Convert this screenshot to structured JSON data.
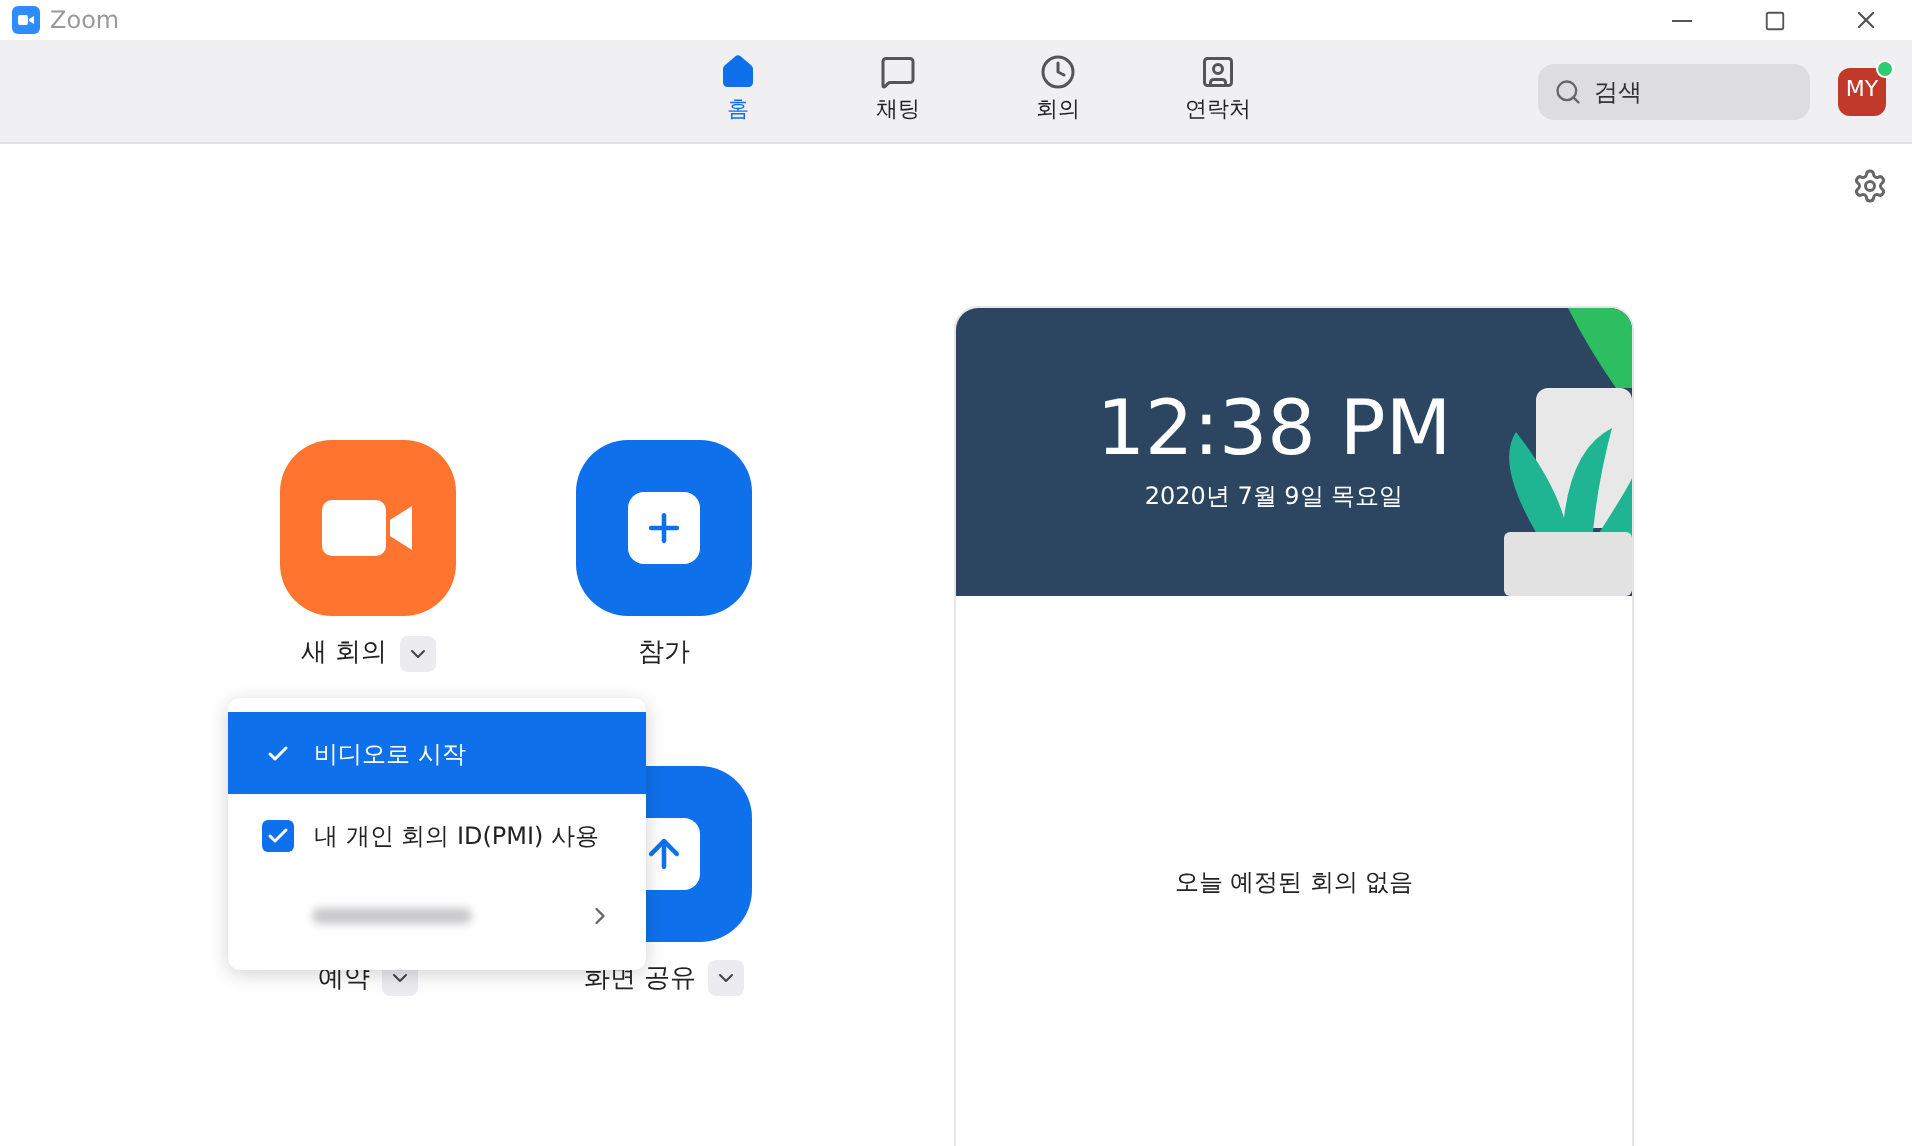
{
  "window": {
    "title": "Zoom"
  },
  "nav": {
    "tabs": [
      {
        "label": "홈",
        "kind": "home",
        "selected": true
      },
      {
        "label": "채팅",
        "kind": "chat",
        "selected": false
      },
      {
        "label": "회의",
        "kind": "clock",
        "selected": false
      },
      {
        "label": "연락처",
        "kind": "contact",
        "selected": false
      }
    ],
    "search": {
      "placeholder": "검색"
    },
    "avatar": {
      "initials": "MY",
      "online": true
    }
  },
  "actions": [
    {
      "label": "새 회의",
      "kind": "video",
      "dropdown": true,
      "tile_covered": false
    },
    {
      "label": "참가",
      "kind": "plus",
      "dropdown": false,
      "tile_covered": false
    },
    {
      "label": "예약",
      "kind": "calendar",
      "dropdown": true,
      "tile_covered": true
    },
    {
      "label": "화면 공유",
      "kind": "share",
      "dropdown": true,
      "tile_covered": false
    }
  ],
  "menu": {
    "items": [
      {
        "kind": "check",
        "label": "비디오로 시작",
        "checked": true,
        "selected": true
      },
      {
        "kind": "checkbox",
        "label": "내 개인 회의 ID(PMI) 사용",
        "checked": true,
        "selected": false
      },
      {
        "kind": "submenu",
        "selected": false
      }
    ]
  },
  "clock": {
    "time": "12:38 PM",
    "date": "2020년 7월 9일 목요일"
  },
  "meetings": {
    "empty_message": "오늘 예정된 회의 없음"
  }
}
